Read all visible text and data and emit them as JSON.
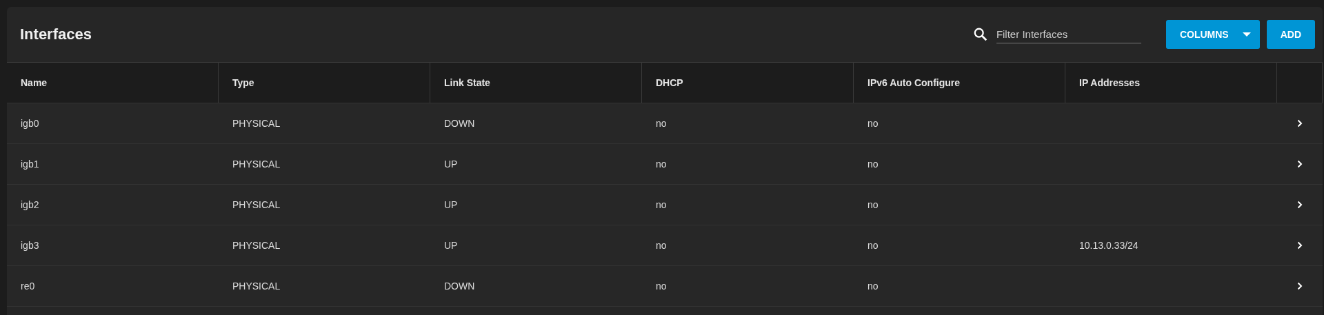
{
  "card": {
    "title": "Interfaces",
    "filter": {
      "placeholder": "Filter Interfaces"
    },
    "buttons": [
      {
        "label": "COLUMNS",
        "kind": "dropdown"
      },
      {
        "label": "ADD",
        "kind": "plain"
      }
    ]
  },
  "table": {
    "columns": [
      "Name",
      "Type",
      "Link State",
      "DHCP",
      "IPv6 Auto Configure",
      "IP Addresses"
    ],
    "rows": [
      {
        "cells": [
          "igb0",
          "PHYSICAL",
          "DOWN",
          "no",
          "no",
          ""
        ]
      },
      {
        "cells": [
          "igb1",
          "PHYSICAL",
          "UP",
          "no",
          "no",
          ""
        ]
      },
      {
        "cells": [
          "igb2",
          "PHYSICAL",
          "UP",
          "no",
          "no",
          ""
        ]
      },
      {
        "cells": [
          "igb3",
          "PHYSICAL",
          "UP",
          "no",
          "no",
          "10.13.0.33/24"
        ]
      },
      {
        "cells": [
          "re0",
          "PHYSICAL",
          "DOWN",
          "no",
          "no",
          ""
        ]
      }
    ]
  }
}
